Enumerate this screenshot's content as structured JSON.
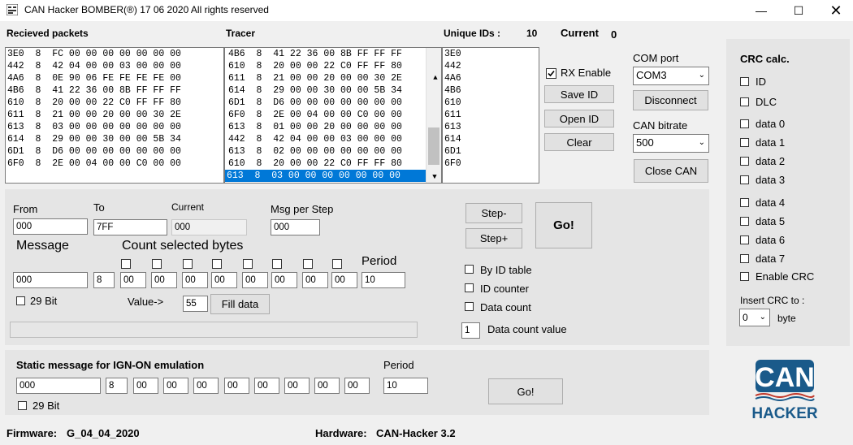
{
  "window": {
    "title": "CAN Hacker BOMBER(®) 17 06 2020   All rights reserved"
  },
  "received": {
    "header": "Recieved packets",
    "rows": [
      "3E0  8  FC 00 00 00 00 00 00 00",
      "442  8  42 04 00 00 03 00 00 00",
      "4A6  8  0E 90 06 FE FE FE FE 00",
      "4B6  8  41 22 36 00 8B FF FF FF",
      "610  8  20 00 00 22 C0 FF FF 80",
      "611  8  21 00 00 20 00 00 30 2E",
      "613  8  03 00 00 00 00 00 00 00",
      "614  8  29 00 00 30 00 00 5B 34",
      "6D1  8  D6 00 00 00 00 00 00 00",
      "6F0  8  2E 00 04 00 00 C0 00 00"
    ]
  },
  "tracer": {
    "header": "Tracer",
    "rows": [
      "4B6  8  41 22 36 00 8B FF FF FF",
      "610  8  20 00 00 22 C0 FF FF 80",
      "611  8  21 00 00 20 00 00 30 2E",
      "614  8  29 00 00 30 00 00 5B 34",
      "6D1  8  D6 00 00 00 00 00 00 00",
      "6F0  8  2E 00 04 00 00 C0 00 00",
      "613  8  01 00 00 20 00 00 00 00",
      "442  8  42 04 00 00 03 00 00 00",
      "613  8  02 00 00 00 00 00 00 00",
      "610  8  20 00 00 22 C0 FF FF 80"
    ],
    "selected": "613  8  03 00 00 00 00 00 00 00"
  },
  "unique": {
    "header": "Unique IDs :",
    "count": "10",
    "current_label": "Current",
    "current_value": "0",
    "rows": [
      "3E0",
      "442",
      "4A6",
      "4B6",
      "610",
      "611",
      "613",
      "614",
      "6D1",
      "6F0"
    ]
  },
  "controls": {
    "rx_enable": "RX Enable",
    "save_id": "Save ID",
    "open_id": "Open ID",
    "clear": "Clear",
    "com_port_label": "COM port",
    "com_port_value": "COM3",
    "disconnect": "Disconnect",
    "can_bitrate_label": "CAN bitrate",
    "can_bitrate_value": "500",
    "close_can": "Close CAN"
  },
  "bomber": {
    "from_label": "From",
    "from_value": "000",
    "to_label": "To",
    "to_value": "7FF",
    "current_label": "Current",
    "current_value": "000",
    "msg_per_step_label": "Msg per Step",
    "msg_per_step_value": "000",
    "message_label": "Message",
    "count_selected_label": "Count selected bytes",
    "message_value": "000",
    "dlc_value": "8",
    "bytes": [
      "00",
      "00",
      "00",
      "00",
      "00",
      "00",
      "00",
      "00"
    ],
    "period_label": "Period",
    "period_value": "10",
    "bit29_label": "29 Bit",
    "value_label": "Value->",
    "value_value": "55",
    "fill_data": "Fill data",
    "step_minus": "Step-",
    "step_plus": "Step+",
    "go": "Go!",
    "by_id_table": "By  ID table",
    "id_counter": "ID counter",
    "data_count": "Data count",
    "data_count_value": "1",
    "data_count_value_label": "Data count value"
  },
  "static": {
    "title": "Static message for IGN-ON emulation",
    "period_label": "Period",
    "message_value": "000",
    "dlc_value": "8",
    "bytes": [
      "00",
      "00",
      "00",
      "00",
      "00",
      "00",
      "00",
      "00"
    ],
    "period_value": "10",
    "bit29_label": "29 Bit",
    "go": "Go!"
  },
  "crc": {
    "title": "CRC calc.",
    "items": [
      "ID",
      "DLC",
      "data 0",
      "data 1",
      "data 2",
      "data 3",
      "data 4",
      "data 5",
      "data 6",
      "data 7",
      "Enable CRC"
    ],
    "insert_label": "Insert CRC to :",
    "insert_value": "0",
    "byte_label": "byte"
  },
  "footer": {
    "firmware_label": "Firmware:",
    "firmware_value": "G_04_04_2020",
    "hardware_label": "Hardware:",
    "hardware_value": "CAN-Hacker 3.2"
  },
  "logo": {
    "line1": "CAN",
    "line2": "HACKER",
    "color": "#1a5a8a",
    "accent": "#c0392b"
  }
}
